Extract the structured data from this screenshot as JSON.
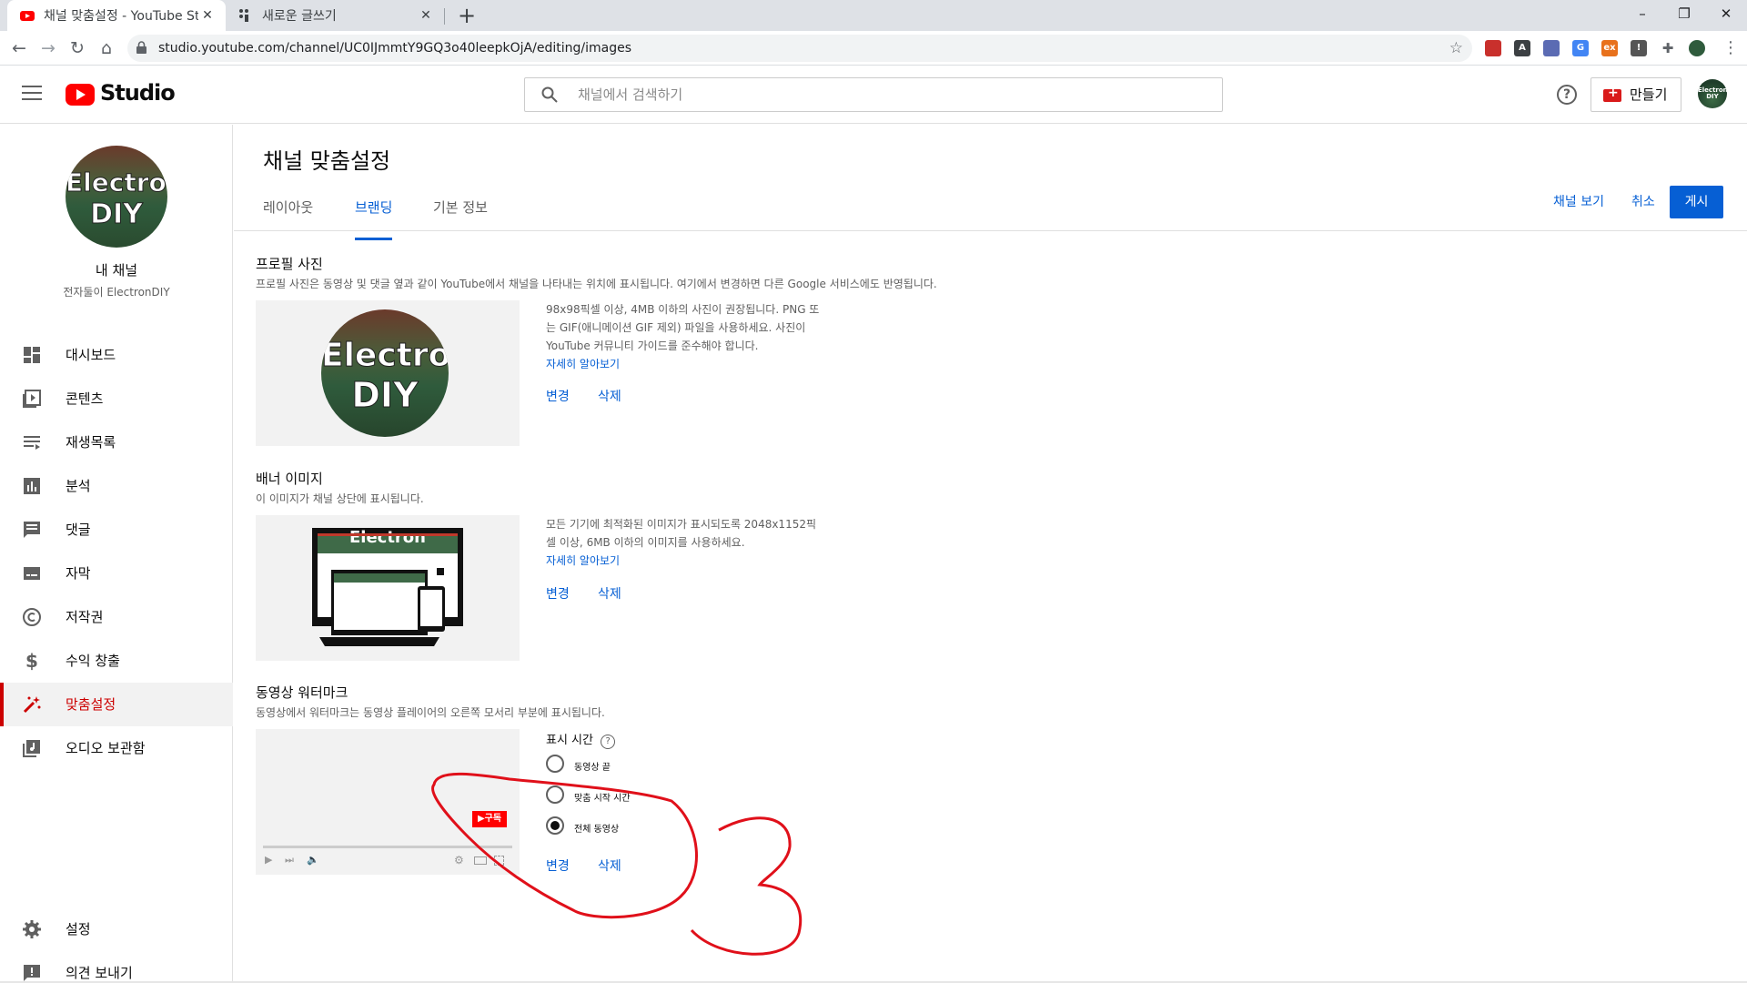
{
  "browser": {
    "tabs": [
      {
        "title": "채널 맞춤설정 - YouTube Studio",
        "close": "✕"
      },
      {
        "title": "새로운 글쓰기",
        "close": "✕"
      }
    ],
    "new_tab": "+",
    "window_controls": {
      "minimize": "–",
      "restore": "❐",
      "close": "✕"
    },
    "url": "studio.youtube.com/channel/UC0IJmmtY9GQ3o40leepkOjA/editing/images"
  },
  "header": {
    "logo_text": "Studio",
    "search_placeholder": "채널에서 검색하기",
    "help": "?",
    "create_label": "만들기"
  },
  "sidebar": {
    "channel_title": "내 채널",
    "channel_name": "전자둘이 ElectronDIY",
    "avatar_text_1": "Electron",
    "avatar_text_2": "DIY",
    "items": [
      {
        "label": "대시보드",
        "icon": "dashboard-icon"
      },
      {
        "label": "콘텐츠",
        "icon": "content-icon"
      },
      {
        "label": "재생목록",
        "icon": "playlist-icon"
      },
      {
        "label": "분석",
        "icon": "analytics-icon"
      },
      {
        "label": "댓글",
        "icon": "comments-icon"
      },
      {
        "label": "자막",
        "icon": "subtitles-icon"
      },
      {
        "label": "저작권",
        "icon": "copyright-icon"
      },
      {
        "label": "수익 창출",
        "icon": "monetization-icon"
      },
      {
        "label": "맞춤설정",
        "icon": "customization-icon"
      },
      {
        "label": "오디오 보관함",
        "icon": "audio-library-icon"
      }
    ],
    "bottom_items": [
      {
        "label": "설정",
        "icon": "settings-icon"
      },
      {
        "label": "의견 보내기",
        "icon": "feedback-icon"
      }
    ],
    "active_item": "맞춤설정"
  },
  "main": {
    "title": "채널 맞춤설정",
    "tabs": [
      {
        "label": "레이아웃"
      },
      {
        "label": "브랜딩"
      },
      {
        "label": "기본 정보"
      }
    ],
    "active_tab": "브랜딩",
    "actions": {
      "view_channel": "채널 보기",
      "cancel": "취소",
      "publish": "게시"
    },
    "profile": {
      "title": "프로필 사진",
      "desc": "프로필 사진은 동영상 및 댓글 옆과 같이 YouTube에서 채널을 나타내는 위치에 표시됩니다. 여기에서 변경하면 다른 Google 서비스에도 반영됩니다.",
      "info_line1": "98x98픽셀 이상, 4MB 이하의 사진이 권장됩니다. PNG 또",
      "info_line2": "는 GIF(애니메이션 GIF 제외) 파일을 사용하세요. 사진이",
      "info_line3": "YouTube 커뮤니티 가이드를 준수해야 합니다.",
      "learn_more": "자세히 알아보기",
      "change": "변경",
      "remove": "삭제",
      "avatar_text_1": "Electron",
      "avatar_text_2": "DIY"
    },
    "banner": {
      "title": "배너 이미지",
      "desc": "이 이미지가 채널 상단에 표시됩니다.",
      "info_line1": "모든 기기에 최적화된 이미지가 표시되도록 2048x1152픽",
      "info_line2": "셀 이상, 6MB 이하의 이미지를 사용하세요.",
      "learn_more": "자세히 알아보기",
      "change": "변경",
      "remove": "삭제"
    },
    "watermark": {
      "title": "동영상 워터마크",
      "desc": "동영상에서 워터마크는 동영상 플레이어의 오른쪽 모서리 부분에 표시됩니다.",
      "display_time_label": "표시 시간",
      "help": "?",
      "options": [
        {
          "label": "동영상 끝"
        },
        {
          "label": "맞춤 시작 시간"
        },
        {
          "label": "전체 동영상"
        }
      ],
      "selected": "전체 동영상",
      "badge": "▶구독",
      "change": "변경",
      "remove": "삭제"
    }
  },
  "colors": {
    "accent": "#065fd4",
    "youtube_red": "#ff0000",
    "active_nav": "#cc0000",
    "annotation": "#e0101a"
  }
}
